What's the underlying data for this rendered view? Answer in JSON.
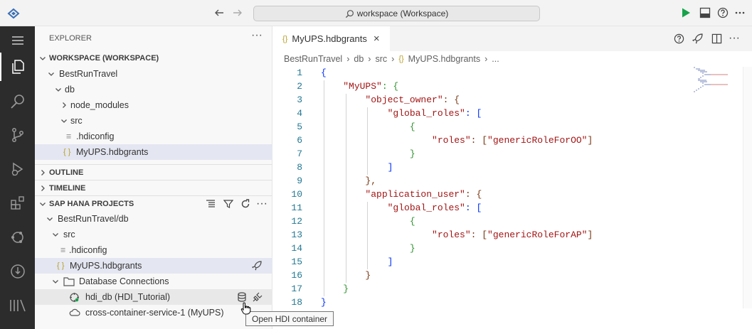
{
  "titlebar": {
    "search_text": "workspace (Workspace)"
  },
  "explorer": {
    "title": "EXPLORER"
  },
  "workspace": {
    "header": "WORKSPACE (WORKSPACE)",
    "items": [
      "BestRunTravel",
      "db",
      "node_modules",
      "src",
      ".hdiconfig",
      "MyUPS.hdbgrants"
    ]
  },
  "outline": {
    "header": "OUTLINE"
  },
  "timeline": {
    "header": "TIMELINE"
  },
  "hana": {
    "header": "SAP HANA PROJECTS",
    "items": [
      "BestRunTravel/db",
      "src",
      ".hdiconfig",
      "MyUPS.hdbgrants",
      "Database Connections",
      "hdi_db (HDI_Tutorial)",
      "cross-container-service-1 (MyUPS)"
    ]
  },
  "editor": {
    "tab_label": "MyUPS.hdbgrants",
    "tab_icon": "{}",
    "breadcrumbs": [
      "BestRunTravel",
      "db",
      "src",
      "MyUPS.hdbgrants",
      "..."
    ],
    "line_numbers": [
      "1",
      "2",
      "3",
      "4",
      "5",
      "6",
      "7",
      "8",
      "9",
      "10",
      "11",
      "12",
      "13",
      "14",
      "15",
      "16",
      "17",
      "18"
    ]
  },
  "tooltip": {
    "text": "Open HDI container"
  },
  "colors": {
    "activity_bg": "#2c2c2c",
    "selection": "#e4e6f1",
    "run_green": "#16a34a",
    "string_red": "#a31515",
    "line_number": "#237893"
  }
}
